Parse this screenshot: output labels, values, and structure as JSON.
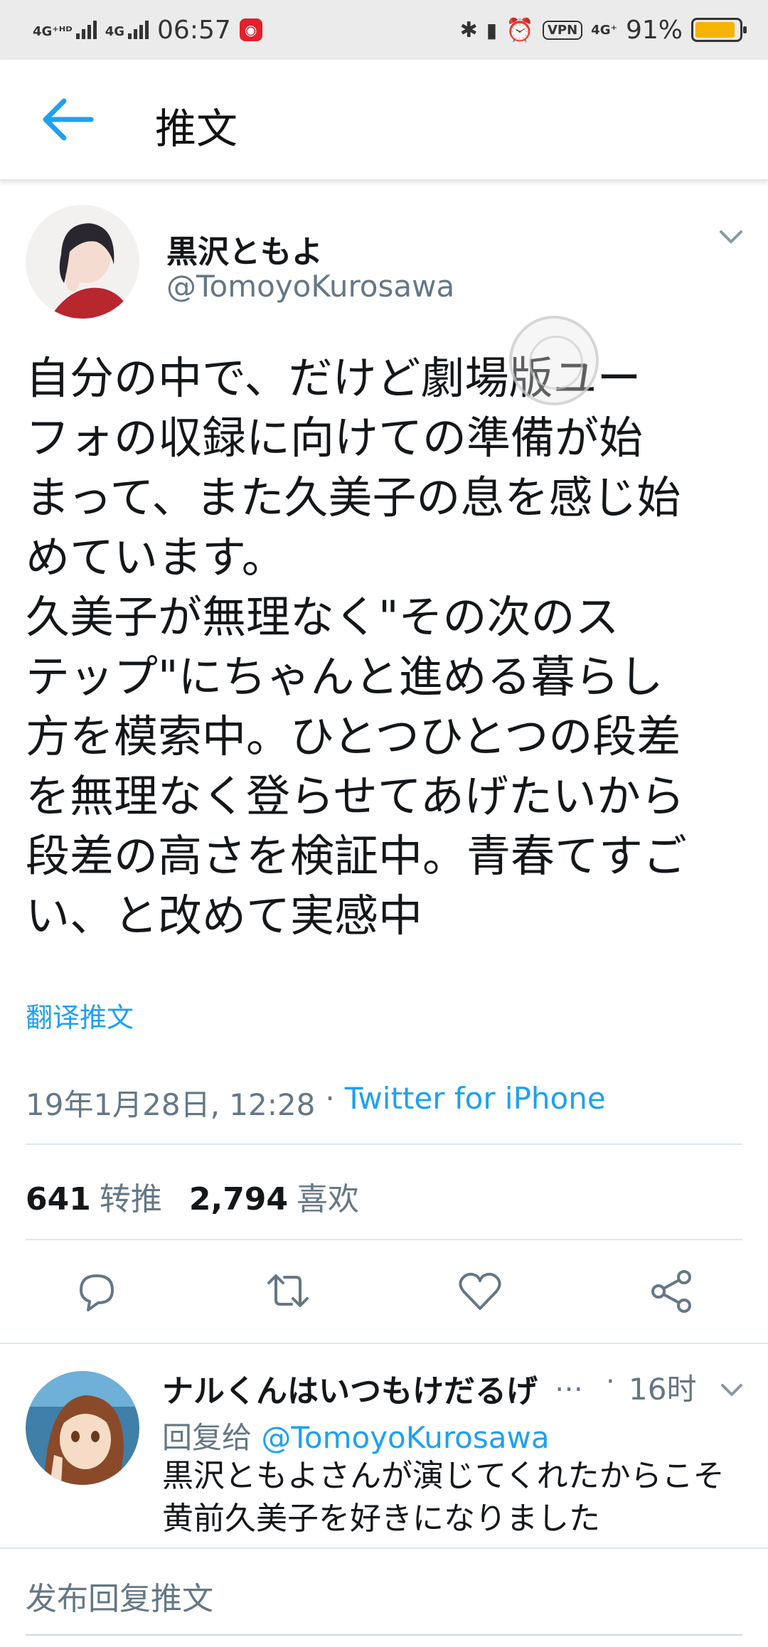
{
  "status_bar": {
    "network1": "4G⁺ᴴᴰ",
    "network2": "4G",
    "time": "06:57",
    "vpn": "VPN",
    "network3": "4G⁺",
    "battery": "91%",
    "battery_level": 0.91
  },
  "header": {
    "title": "推文"
  },
  "tweet": {
    "author_name": "黒沢ともよ",
    "author_handle": "@TomoyoKurosawa",
    "text": "自分の中で、だけど劇場版ユー\nフォの収録に向けての準備が始\nまって、また久美子の息を感じ始\nめています。\n久美子が無理なく\"その次のス\nテップ\"にちゃんと進める暮らし\n方を模索中。ひとつひとつの段差\nを無理なく登らせてあげたいから\n段差の高さを検証中。青春てすご\nい、と改めて実感中",
    "translate_label": "翻译推文",
    "date": "19年1月28日, 12:28",
    "separator": "·",
    "source": "Twitter for iPhone",
    "retweet_count": "641",
    "retweet_label": "转推",
    "like_count": "2,794",
    "like_label": "喜欢"
  },
  "reply": {
    "author_name": "ナルくんはいつもけだるげ",
    "more": "…",
    "separator": "·",
    "time": "16时",
    "reply_to_label": "回复给",
    "reply_to_handle": "@TomoyoKurosawa",
    "text": "黒沢ともよさんが演じてくれたからこそ\n黄前久美子を好きになりました"
  },
  "composer": {
    "placeholder": "发布回复推文"
  },
  "colors": {
    "accent": "#1da1f2",
    "secondary_text": "#657786",
    "divider": "#e1e8ed"
  }
}
